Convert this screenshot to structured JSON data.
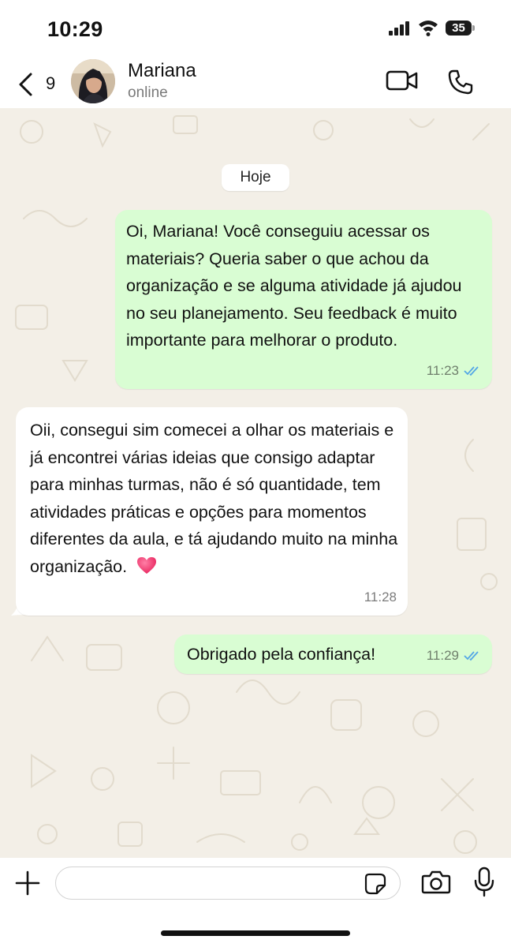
{
  "status_bar": {
    "time": "10:29",
    "battery": "35"
  },
  "header": {
    "back_count": "9",
    "contact_name": "Mariana",
    "contact_status": "online"
  },
  "chat": {
    "date_separator": "Hoje",
    "messages": [
      {
        "direction": "outgoing",
        "text": "Oi, Mariana! Você conseguiu acessar os materiais? Queria saber o que achou da organização e se alguma atividade já ajudou no seu planejamento. Seu feedback é muito importante para melhorar o produto.",
        "time": "11:23",
        "read": true
      },
      {
        "direction": "incoming",
        "text": "Oii, consegui sim comecei a olhar os materiais e já encontrei várias ideias que consigo adaptar para minhas turmas, não é só quantidade, tem atividades práticas e opções para momentos diferentes da aula, e tá ajudando muito na minha organização.",
        "emoji": "heart-emoji",
        "time": "11:28"
      },
      {
        "direction": "outgoing",
        "text": "Obrigado pela confiança!",
        "time": "11:29",
        "read": true
      }
    ]
  },
  "composer": {
    "placeholder": ""
  },
  "icons": {
    "back": "chevron-left-icon",
    "video": "video-call-icon",
    "call": "phone-icon",
    "plus": "plus-icon",
    "sticker": "sticker-icon",
    "camera": "camera-icon",
    "mic": "microphone-icon",
    "tick": "double-check-icon"
  },
  "colors": {
    "outgoing_bubble": "#d9fdd3",
    "incoming_bubble": "#ffffff",
    "chat_background": "#f3efe7",
    "read_tick": "#53a6e6"
  }
}
